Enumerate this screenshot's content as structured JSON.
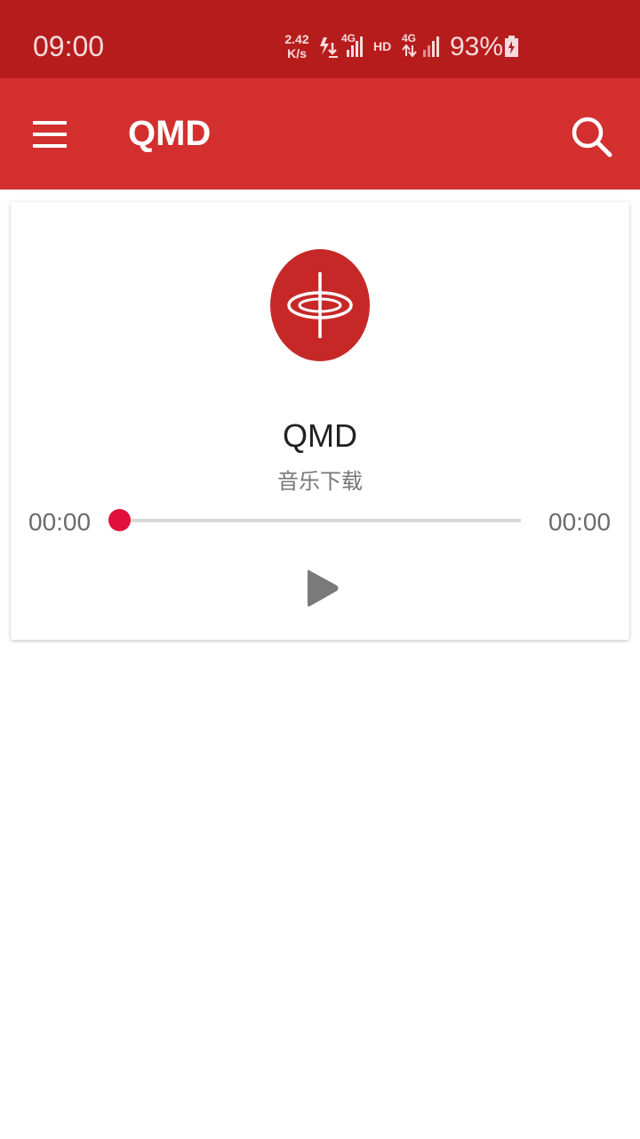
{
  "status_bar": {
    "time": "09:00",
    "net_speed_value": "2.42",
    "net_speed_unit": "K/s",
    "network_labels": [
      "4G",
      "HD",
      "4G"
    ],
    "battery_percent": "93%",
    "icons": [
      "data-arrows-icon",
      "signal-icon",
      "hd-icon",
      "signal-icon",
      "battery-charging-icon"
    ]
  },
  "app_bar": {
    "title": "QMD",
    "menu_icon": "hamburger-menu-icon",
    "search_icon": "search-icon",
    "color": "#d32f2f"
  },
  "player": {
    "logo_icon": "qmd-logo-icon",
    "title": "QMD",
    "subtitle": "音乐下载",
    "elapsed": "00:00",
    "duration": "00:00",
    "progress": 0,
    "play_icon": "play-icon",
    "accent_color": "#e0103a"
  }
}
